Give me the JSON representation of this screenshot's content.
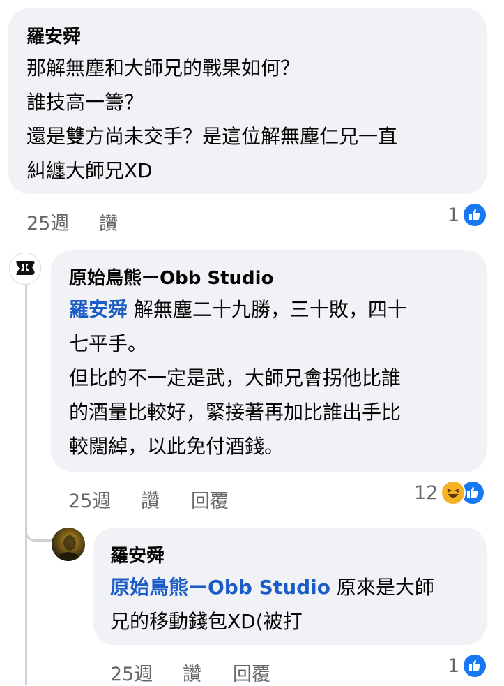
{
  "comment1": {
    "author": "羅安舜",
    "lines": [
      "那解無塵和大師兄的戰果如何？",
      "誰技高一籌？",
      "還是雙方尚未交手？是這位解無塵仁兄一直",
      "糾纏大師兄XD"
    ],
    "time": "25週",
    "like": "讚",
    "reaction_count": "1"
  },
  "comment2": {
    "author": "原始鳥熊ーObb Studio",
    "mention": "羅安舜",
    "line1_rest": " 解無塵二十九勝，三十敗，四十",
    "lines": [
      "七平手。",
      "但比的不一定是武，大師兄會拐他比誰",
      "的酒量比較好，緊接著再加比誰出手比",
      "較闊綽，以此免付酒錢。"
    ],
    "time": "25週",
    "like": "讚",
    "reply": "回覆",
    "reaction_count": "12"
  },
  "comment3": {
    "author": "羅安舜",
    "mention": "原始鳥熊ーObb Studio",
    "line1_rest": " 原來是大師",
    "lines": [
      "兄的移動錢包XD(被打"
    ],
    "time": "25週",
    "like": "讚",
    "reply": "回覆",
    "reaction_count": "1"
  },
  "colors": {
    "bubble": "#f0f2f5",
    "mention": "#1b5cc6",
    "like_blue": "#1877f2",
    "meta_gray": "#65676b"
  },
  "icons": [
    "like-icon",
    "haha-icon",
    "studio-logo-avatar",
    "user-avatar"
  ]
}
